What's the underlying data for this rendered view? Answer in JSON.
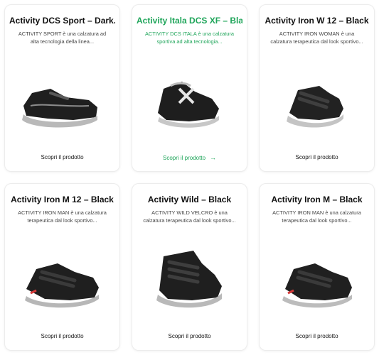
{
  "products": [
    {
      "title": "Activity DCS Sport – Dark...",
      "desc": "ACTIVITY SPORT è una calzatura ad alta tecnologia della linea...",
      "cta": "Scopri il prodotto",
      "active": false
    },
    {
      "title": "Activity Itala DCS XF – Black",
      "desc": "ACTIVITY DCS ITALA è una calzatura sportiva ad alta tecnologia...",
      "cta": "Scopri il prodotto",
      "arrow": "→",
      "active": true
    },
    {
      "title": "Activity Iron W 12 – Black",
      "desc": "ACTIVITY IRON WOMAN è una calzatura terapeutica dal look sportivo...",
      "cta": "Scopri il prodotto",
      "active": false
    },
    {
      "title": "Activity Iron M 12 – Black",
      "desc": "ACTIVITY IRON MAN è una calzatura terapeutica dal look sportivo...",
      "cta": "Scopri il prodotto",
      "active": false
    },
    {
      "title": "Activity Wild – Black",
      "desc": "ACTIVITY WILD VELCRO è una calzatura terapeutica dal look sportivo...",
      "cta": "Scopri il prodotto",
      "active": false
    },
    {
      "title": "Activity Iron M – Black",
      "desc": "ACTIVITY IRON MAN è una calzatura terapeutica dal look sportivo...",
      "cta": "Scopri il prodotto",
      "active": false
    }
  ],
  "colors": {
    "accent": "#1fa55a",
    "text": "#111111",
    "muted": "#444444"
  }
}
